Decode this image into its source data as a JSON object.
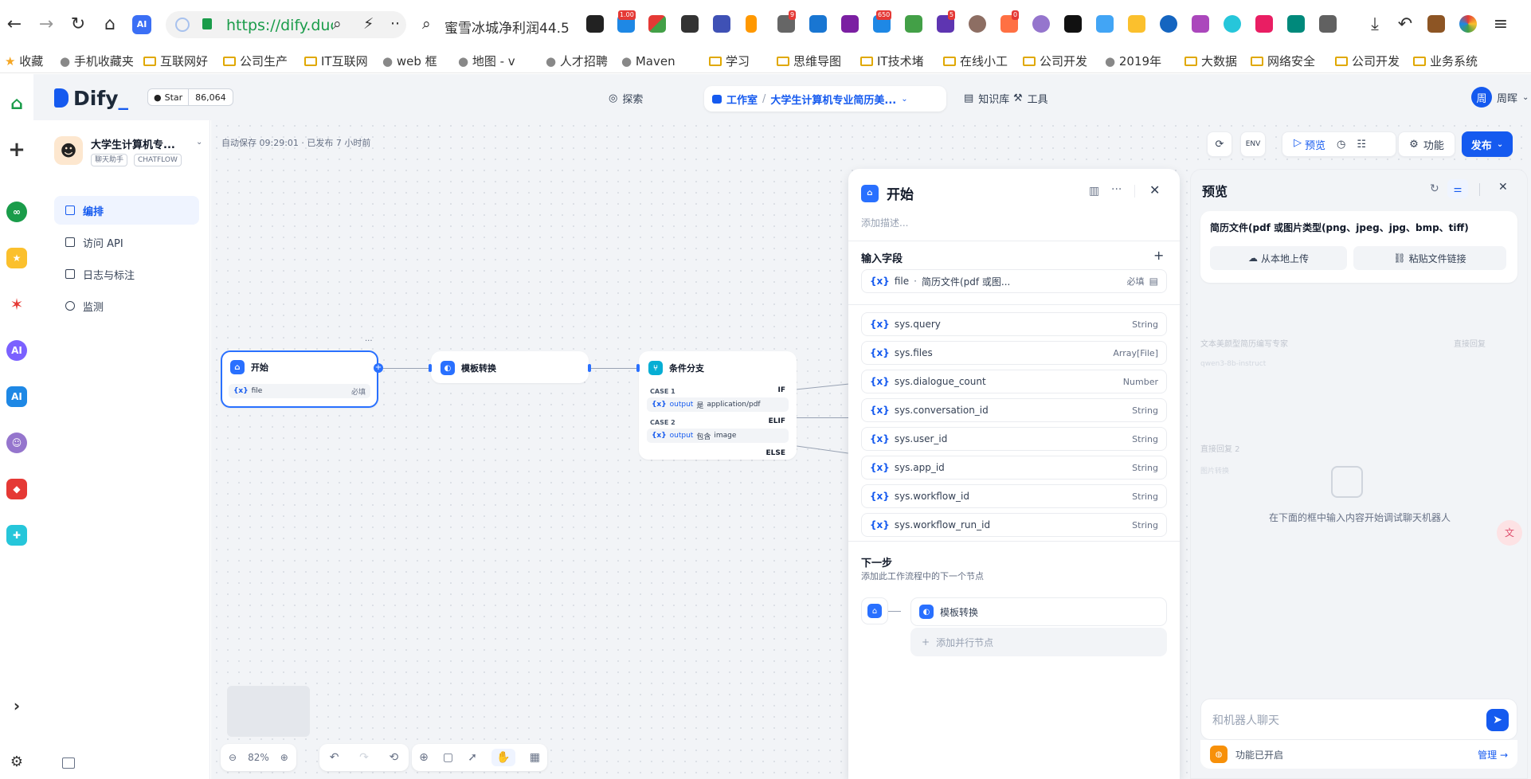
{
  "browser": {
    "url": "https://dify.duc",
    "search_text": "蜜雪冰城净利润44.5亿",
    "badges": [
      "1.00",
      "9",
      "650",
      "5",
      "0"
    ],
    "bookmarks": [
      {
        "label": "收藏",
        "kind": "star"
      },
      {
        "label": "手机收藏夹",
        "kind": "phone"
      },
      {
        "label": "互联网好",
        "kind": "folder"
      },
      {
        "label": "公司生产",
        "kind": "folder"
      },
      {
        "label": "IT互联网",
        "kind": "folder"
      },
      {
        "label": "web 框",
        "kind": "site"
      },
      {
        "label": "地图 - v",
        "kind": "site"
      },
      {
        "label": "人才招聘",
        "kind": "site"
      },
      {
        "label": "Maven",
        "kind": "site"
      },
      {
        "label": "学习",
        "kind": "folder"
      },
      {
        "label": "思维导图",
        "kind": "folder"
      },
      {
        "label": "IT技术堵",
        "kind": "folder"
      },
      {
        "label": "在线小工",
        "kind": "folder"
      },
      {
        "label": "公司开发",
        "kind": "folder"
      },
      {
        "label": "2019年",
        "kind": "site"
      },
      {
        "label": "大数据",
        "kind": "folder"
      },
      {
        "label": "网络安全",
        "kind": "folder"
      },
      {
        "label": "公司开发",
        "kind": "folder"
      },
      {
        "label": "业务系统",
        "kind": "folder"
      }
    ]
  },
  "header": {
    "logo": "Dify",
    "star_label": "Star",
    "star_count": "86,064",
    "explore": "探索",
    "workroom": "工作室",
    "app_crumb": "大学生计算机专业简历美...",
    "knowledge": "知识库",
    "tools": "工具",
    "user_initial": "周",
    "user_name": "周晖"
  },
  "sidebar": {
    "app_name": "大学生计算机专...",
    "tag1": "聊天助手",
    "tag2": "CHATFLOW",
    "items": [
      {
        "label": "编排",
        "active": true
      },
      {
        "label": "访问 API",
        "active": false
      },
      {
        "label": "日志与标注",
        "active": false
      },
      {
        "label": "监测",
        "active": false
      }
    ]
  },
  "canvas": {
    "autosave": "自动保存 09:29:01 · 已发布 7 小时前",
    "start_node": {
      "title": "开始",
      "var": "{x}",
      "field": "file",
      "required": "必填"
    },
    "template_node": {
      "title": "模板转换"
    },
    "branch_node": {
      "title": "条件分支",
      "case1": "CASE 1",
      "if": "IF",
      "case1_cond_var": "output",
      "case1_op": "是",
      "case1_val": "application/pdf",
      "case2": "CASE 2",
      "elif": "ELIF",
      "case2_cond_var": "output",
      "case2_op": "包含",
      "case2_val": "image",
      "else": "ELSE"
    },
    "zoom": "82%"
  },
  "topright": {
    "preview": "预览",
    "features": "功能",
    "publish": "发布"
  },
  "start_panel": {
    "title": "开始",
    "desc_placeholder": "添加描述...",
    "input_fields_label": "输入字段",
    "file_field": {
      "var": "{x}",
      "name": "file",
      "desc": "简历文件(pdf 或图...",
      "required": "必填"
    },
    "sys_fields": [
      {
        "name": "sys.query",
        "type": "String"
      },
      {
        "name": "sys.files",
        "type": "Array[File]"
      },
      {
        "name": "sys.dialogue_count",
        "type": "Number"
      },
      {
        "name": "sys.conversation_id",
        "type": "String"
      },
      {
        "name": "sys.user_id",
        "type": "String"
      },
      {
        "name": "sys.app_id",
        "type": "String"
      },
      {
        "name": "sys.workflow_id",
        "type": "String"
      },
      {
        "name": "sys.workflow_run_id",
        "type": "String"
      }
    ],
    "next_label": "下一步",
    "next_desc": "添加此工作流程中的下一个节点",
    "next_node": "模板转换",
    "add_parallel": "添加并行节点"
  },
  "preview_panel": {
    "title": "预览",
    "file_label": "简历文件(pdf 或图片类型(png、jpeg、jpg、bmp、tiff)",
    "upload_local": "从本地上传",
    "paste_link": "粘贴文件链接",
    "bg_node1": "文本美颜型简历编写专家",
    "bg_node1_model": "qwen3-8b-instruct",
    "bg_node2": "直接回复",
    "bg_node3": "直接回复 2",
    "bg_node3_sub": "图片转换",
    "empty_hint": "在下面的框中输入内容开始调试聊天机器人",
    "chat_placeholder": "和机器人聊天",
    "features_on": "功能已开启",
    "manage": "管理 →"
  },
  "colors": {
    "accent": "#155aef",
    "secure": "#1a9c4a",
    "canvas_bg": "#f2f4f7"
  }
}
